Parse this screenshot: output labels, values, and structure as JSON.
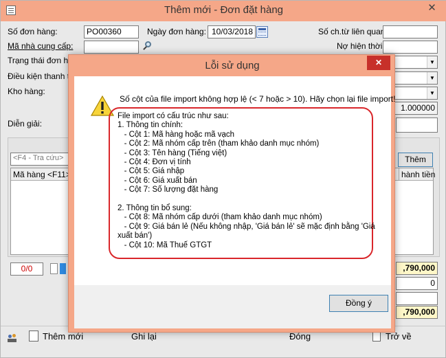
{
  "window": {
    "title": "Thêm mới - Đơn đặt hàng",
    "close": "✕"
  },
  "form": {
    "order_no_label": "Số đơn hàng:",
    "order_no_value": "PO00360",
    "order_date_label": "Ngày đơn hàng:",
    "order_date_value": "10/03/2018",
    "voucher_no_label": "Số ch.từ liên quan:",
    "supplier_label": "Mã nhà cung cấp:",
    "current_debt_label": "Nợ hiện thời:",
    "status_label": "Trạng thái đơn hàng",
    "payment_terms_label": "Điều kiện thanh to",
    "warehouse_label": "Kho hàng:",
    "rate_value": "1.000000",
    "description_label": "Diễn giải:"
  },
  "grid": {
    "search_placeholder": "<F4 - Tra cứu>",
    "col_item_code": "Mã hàng <F11>",
    "col_amount": "hành tiền",
    "add_button": "Thêm",
    "page_counter": "0/0"
  },
  "totals": {
    "total1": ",790,000",
    "discount": "0",
    "total2": ",790,000"
  },
  "bottom_bar": {
    "add_label": "Thêm mới",
    "save_label": "Ghi lại",
    "close_label": "Đóng",
    "back_label": "Trở về"
  },
  "dialog": {
    "title": "Lỗi sử dụng",
    "close": "✕",
    "message": "Số cột của file import không hợp lệ (< 7 hoặc > 10). Hãy chọn lại file import!",
    "structure_text": "File import có cấu trúc như sau:\n1. Thông tin chính:\n   - Cột 1: Mã hàng hoặc mã vạch\n   - Cột 2: Mã nhóm cấp trên (tham khảo danh mục nhóm)\n   - Cột 3: Tên hàng (Tiếng việt)\n   - Cột 4: Đơn vị tính\n   - Cột 5: Giá nhập\n   - Cột 6: Giá xuất bán\n   - Cột 7: Số lượng đặt hàng\n\n2. Thông tin bổ sung:\n   - Cột 8: Mã nhóm cấp dưới (tham khảo danh mục nhóm)\n   - Cột 9: Giá bán lẻ (Nếu không nhập, 'Giá bán lẻ' sẽ mặc định bằng 'Giá\nxuất bán')\n   - Cột 10: Mã Thuế GTGT",
    "ok_label": "Đồng ý"
  },
  "colors": {
    "title_bar": "#f5a788",
    "highlight_red": "#d9262a",
    "close_red": "#c7302a"
  }
}
